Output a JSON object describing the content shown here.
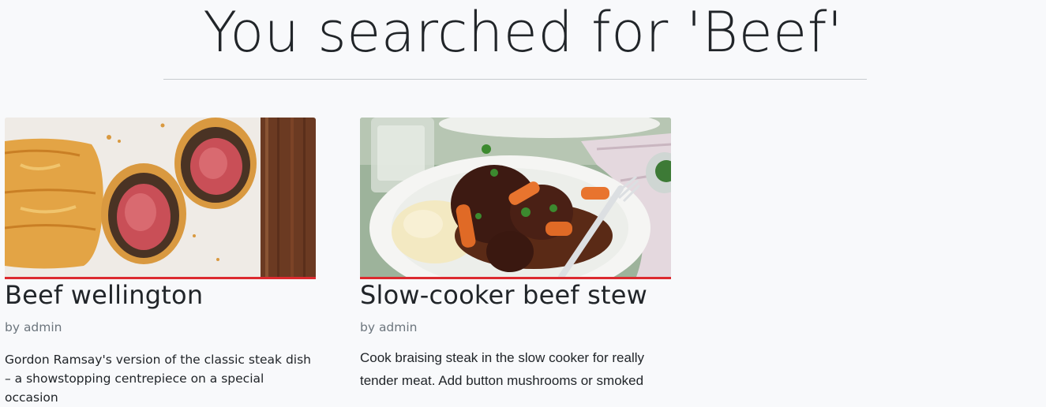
{
  "page": {
    "heading": "You searched for 'Beef'"
  },
  "results": [
    {
      "title": "Beef wellington",
      "author": "by admin",
      "description": "Gordon Ramsay's version of the classic steak dish – a showstopping centrepiece on a special occasion",
      "image_icon": "beef-wellington-photo"
    },
    {
      "title": "Slow-cooker beef stew",
      "author": "by admin",
      "description": "Cook braising steak in the slow cooker for really tender meat. Add button mushrooms or smoked",
      "image_icon": "beef-stew-photo"
    }
  ],
  "colors": {
    "accent": "#dc2a2f",
    "background": "#f8f9fb",
    "text": "#212529",
    "muted": "#6c757d"
  }
}
